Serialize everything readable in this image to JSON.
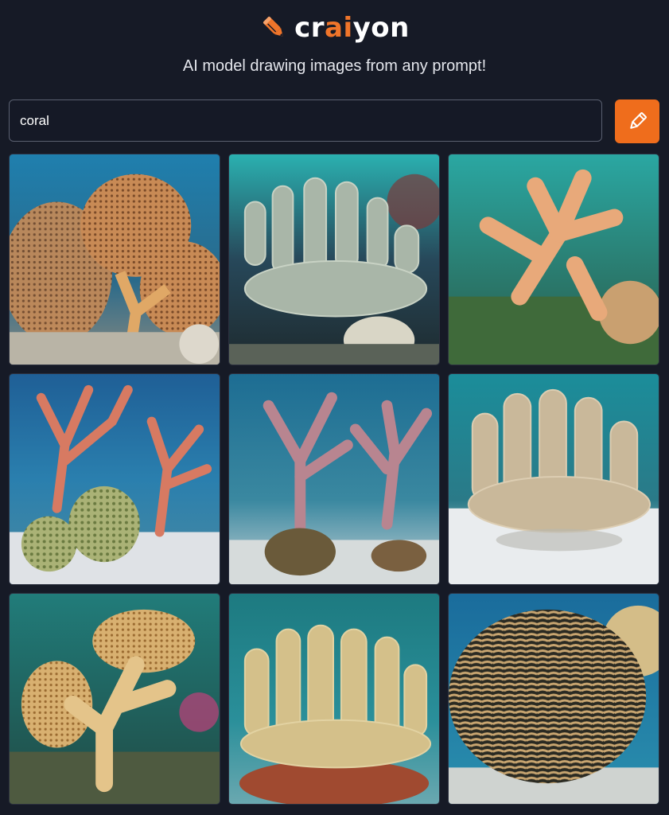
{
  "brand": {
    "name_prefix": "cr",
    "name_accent": "ai",
    "name_suffix": "yon",
    "accent_color": "#f0752a",
    "logo_icon": "pencil-icon"
  },
  "tagline": "AI model drawing images from any prompt!",
  "search": {
    "value": "coral",
    "button_icon": "pencil-icon",
    "button_color": "#ef6d1c"
  },
  "results": [
    {
      "subject": "orange sea fan coral"
    },
    {
      "subject": "pale grey branching coral"
    },
    {
      "subject": "peach staghorn coral"
    },
    {
      "subject": "pink branching coral with green brain corals"
    },
    {
      "subject": "mauve branching coral"
    },
    {
      "subject": "beige finger coral"
    },
    {
      "subject": "golden branching coral"
    },
    {
      "subject": "sandy finger coral"
    },
    {
      "subject": "brain coral"
    }
  ]
}
